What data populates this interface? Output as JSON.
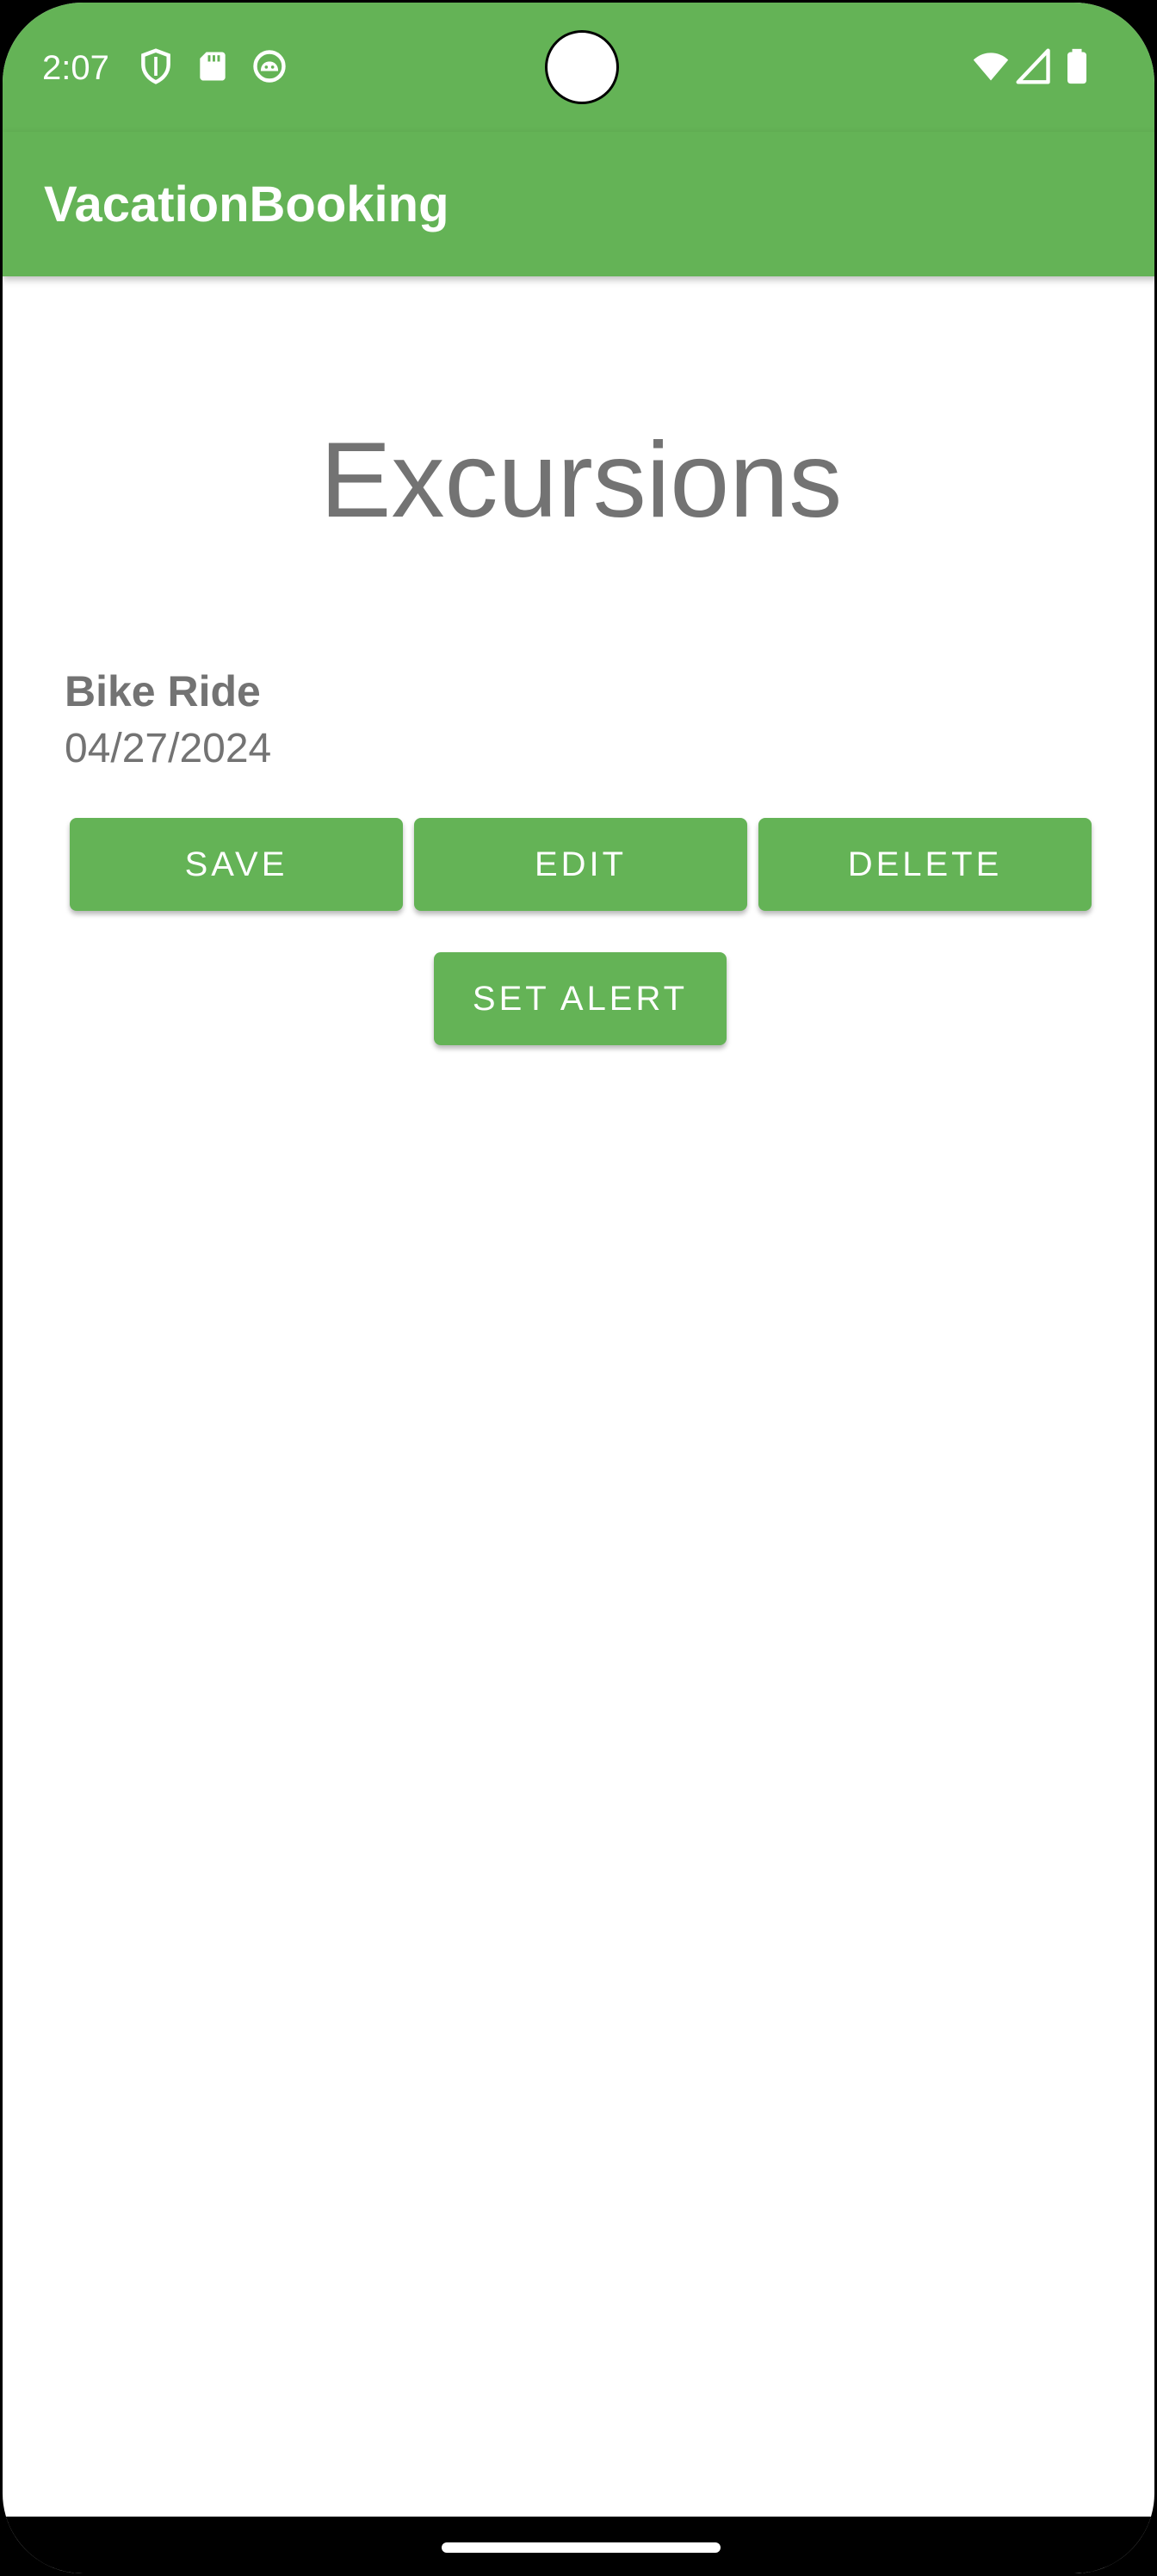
{
  "status_bar": {
    "time": "2:07",
    "icons_left": [
      "shield-icon",
      "sd-card-icon",
      "android-debug-icon"
    ],
    "icons_right": [
      "wifi-icon",
      "cell-signal-icon",
      "battery-icon"
    ],
    "background": "#64b356"
  },
  "app_bar": {
    "title": "VacationBooking",
    "background": "#64b356"
  },
  "main": {
    "heading": "Excursions",
    "excursion": {
      "name": "Bike Ride",
      "date": "04/27/2024"
    },
    "buttons": {
      "save": "SAVE",
      "edit": "EDIT",
      "delete": "DELETE",
      "set_alert": "SET ALERT"
    }
  },
  "colors": {
    "accent": "#64b356",
    "text_gray": "#737373"
  }
}
